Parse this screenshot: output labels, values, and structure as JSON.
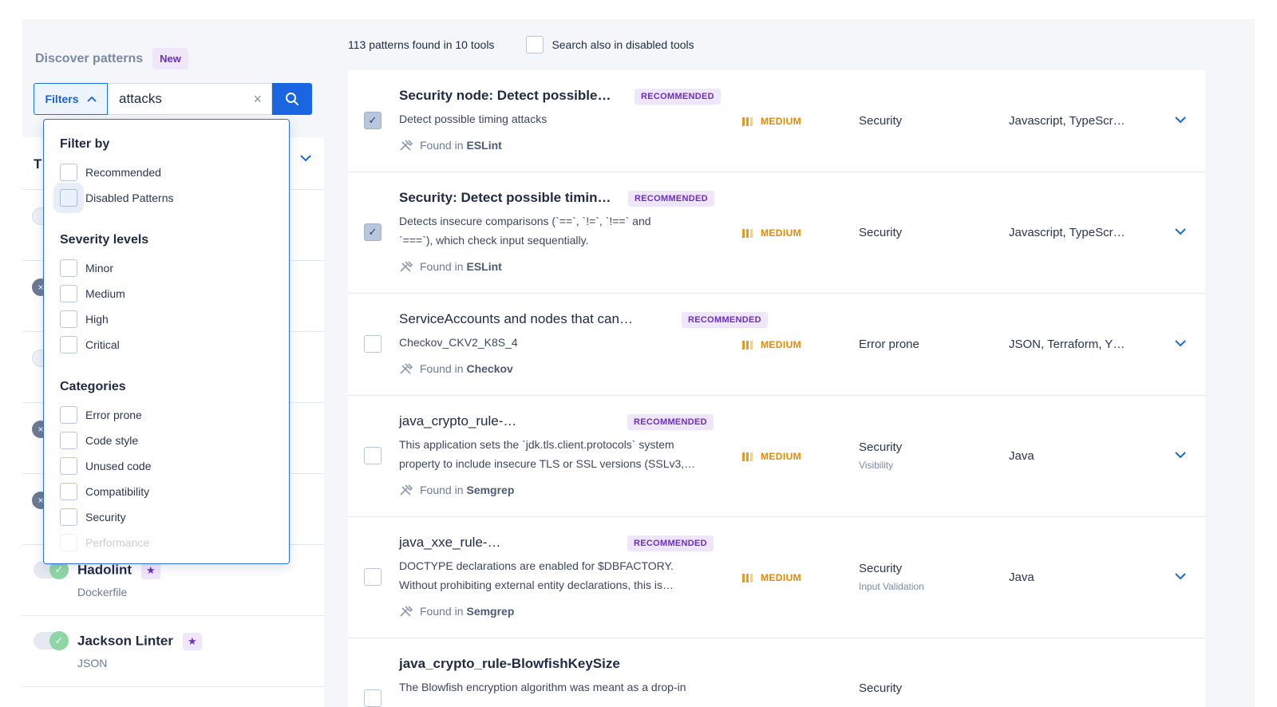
{
  "discover": {
    "title": "Discover patterns",
    "badge": "New"
  },
  "search": {
    "filters_label": "Filters",
    "value": "attacks"
  },
  "filter_dropdown": {
    "filter_by_title": "Filter by",
    "filter_by": [
      "Recommended",
      "Disabled Patterns"
    ],
    "severity_title": "Severity levels",
    "severity": [
      "Minor",
      "Medium",
      "High",
      "Critical"
    ],
    "categories_title": "Categories",
    "categories": [
      "Error prone",
      "Code style",
      "Unused code",
      "Compatibility",
      "Security",
      "Performance"
    ]
  },
  "tools": {
    "header_letter": "T",
    "items": [
      {
        "name": "Hadolint",
        "language": "Dockerfile"
      },
      {
        "name": "Jackson Linter",
        "language": "JSON"
      }
    ]
  },
  "results": {
    "found_text": "113 patterns found in 10 tools",
    "search_disabled_label": "Search also in disabled tools",
    "found_in_prefix": "Found in"
  },
  "patterns": [
    {
      "title": "Security node: Detect possible…",
      "badge": "RECOMMENDED",
      "desc1": "Detect possible timing attacks",
      "desc2": "",
      "tool": "ESLint",
      "severity": "MEDIUM",
      "category": "Security",
      "subcategory": "",
      "languages": "Javascript, TypeScr…",
      "checked": true
    },
    {
      "title": "Security: Detect possible timin…",
      "badge": "RECOMMENDED",
      "desc1": "Detects insecure comparisons (`==`, `!=`, `!==` and",
      "desc2": "`===`), which check input sequentially.",
      "tool": "ESLint",
      "severity": "MEDIUM",
      "category": "Security",
      "subcategory": "",
      "languages": "Javascript, TypeScr…",
      "checked": true
    },
    {
      "title": "ServiceAccounts and nodes that can…",
      "badge": "RECOMMENDED",
      "desc1": "Checkov_CKV2_K8S_4",
      "desc2": "",
      "tool": "Checkov",
      "severity": "MEDIUM",
      "category": "Error prone",
      "subcategory": "",
      "languages": "JSON, Terraform, Y…",
      "checked": false
    },
    {
      "title": "java_crypto_rule-…",
      "badge": "RECOMMENDED",
      "desc1": "This application sets the `jdk.tls.client.protocols` system",
      "desc2": "property to include insecure TLS or SSL versions (SSLv3,…",
      "tool": "Semgrep",
      "severity": "MEDIUM",
      "category": "Security",
      "subcategory": "Visibility",
      "languages": "Java",
      "checked": false
    },
    {
      "title": "java_xxe_rule-…",
      "badge": "RECOMMENDED",
      "desc1": "DOCTYPE declarations are enabled for $DBFACTORY.",
      "desc2": "Without prohibiting external entity declarations, this is…",
      "tool": "Semgrep",
      "severity": "MEDIUM",
      "category": "Security",
      "subcategory": "Input Validation",
      "languages": "Java",
      "checked": false
    },
    {
      "title": "java_crypto_rule-BlowfishKeySize",
      "badge": "",
      "desc1": "The Blowfish encryption algorithm was meant as a drop-in",
      "desc2": "",
      "tool": "",
      "severity": "",
      "category": "Security",
      "subcategory": "",
      "languages": "",
      "checked": false
    }
  ]
}
